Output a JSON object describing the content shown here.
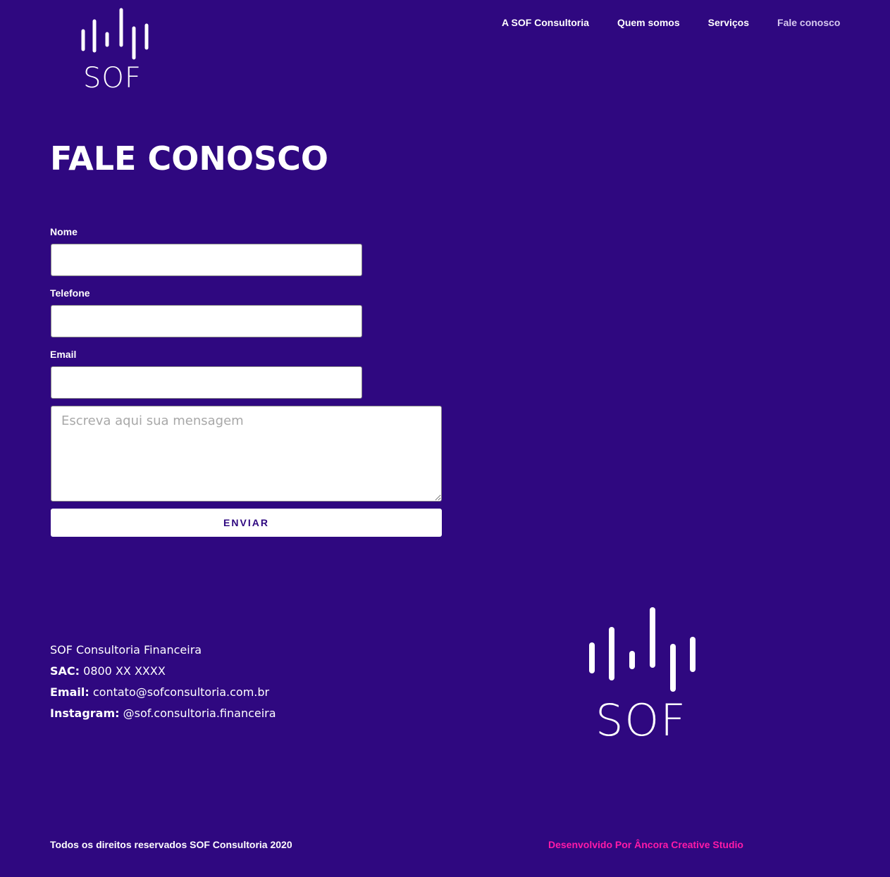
{
  "header": {
    "logo_text": "SOF",
    "nav": [
      {
        "label": "A SOF Consultoria",
        "active": false
      },
      {
        "label": "Quem somos",
        "active": false
      },
      {
        "label": "Serviços",
        "active": false
      },
      {
        "label": "Fale conosco",
        "active": true
      }
    ]
  },
  "main": {
    "title": "FALE CONOSCO",
    "form": {
      "name_label": "Nome",
      "name_value": "",
      "phone_label": "Telefone",
      "phone_value": "",
      "email_label": "Email",
      "email_value": "",
      "message_placeholder": "Escreva aqui sua mensagem",
      "submit_label": "ENVIAR"
    }
  },
  "footer": {
    "company": "SOF Consultoria Financeira",
    "sac_label": "SAC:",
    "sac_value": "0800 XX XXXX",
    "email_label": "Email:",
    "email_value": "contato@sofconsultoria.com.br",
    "instagram_label": "Instagram:",
    "instagram_value": "@sof.consultoria.financeira",
    "logo_text": "SOF",
    "copyright": "Todos os direitos reservados SOF Consultoria 2020",
    "credit": "Desenvolvido Por Âncora Creative Studio"
  },
  "colors": {
    "background": "#2f0880",
    "text": "#ffffff",
    "accent_link": "#ff1aa8"
  }
}
